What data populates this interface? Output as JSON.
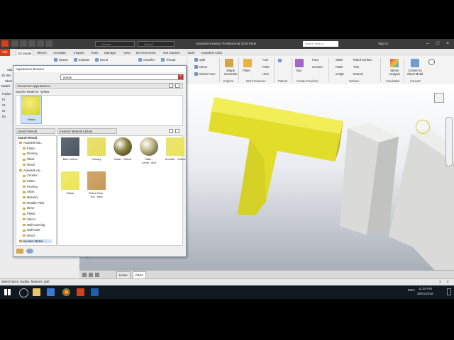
{
  "titlebar": {
    "app_title": "Autodesk Inventor Professional 2018    Part4",
    "style_combo": "Generic",
    "default_combo": "Default",
    "help_search_placeholder": "Search Help & Commands...",
    "signin": "Sign In"
  },
  "tabs": [
    "File",
    "3D Model",
    "Sketch",
    "Annotate",
    "Inspect",
    "Tools",
    "Manage",
    "View",
    "Environments",
    "Get Started",
    "Vault",
    "Autodesk A360"
  ],
  "ribbon": {
    "left_labels": [
      "Sweep",
      "Emboss",
      "Decal",
      "Chamfer",
      "Thread"
    ],
    "left_stubs": [
      "Star",
      "2D Ske",
      "Sketc"
    ],
    "modify": [
      "Split",
      "Direct",
      "Delete Face"
    ],
    "explore": {
      "label": "Shape Generator",
      "group": "Explore"
    },
    "plane": {
      "label": "Plane",
      "axis": "Axis",
      "point": "Point",
      "ucs": "UCS",
      "group": "Work Features"
    },
    "pattern_group": "Pattern",
    "freeform": {
      "box": "Box",
      "face": "Face",
      "convert": "Convert",
      "group": "Create Freeform"
    },
    "surface": {
      "items": [
        "Stitch",
        "Patch",
        "Sculpt",
        "Ruled Surface",
        "Trim",
        "Extend"
      ],
      "group": "Surface"
    },
    "simulation": {
      "label": "Stress Analysis",
      "group": "Simulation"
    },
    "convert": {
      "label": "Convert to Sheet Metal",
      "group": "Convert"
    }
  },
  "browser": {
    "model_label": "Model",
    "rows": [
      "Fusion",
      "Hi",
      "Sc",
      "Or",
      "En"
    ]
  },
  "dialog": {
    "title": "Appearance Browser",
    "search_value": "yellow",
    "doc_appearances": "Document Appearances",
    "search_results_for": "Search results for \"yellow\"",
    "doc_swatch_label": "Yellow",
    "search_result_dropdown": "Search Result",
    "library_dropdown": "Inventor Material Library",
    "tree_header": "Search Result",
    "tree": [
      {
        "label": "Autodesk Ma...",
        "level": 1
      },
      {
        "label": "Fabric",
        "level": 2
      },
      {
        "label": "Flooring",
        "level": 2
      },
      {
        "label": "Glass",
        "level": 2
      },
      {
        "label": "Wood",
        "level": 2
      },
      {
        "label": "Autodesk Ap...",
        "level": 1
      },
      {
        "label": "Ceramic",
        "level": 2
      },
      {
        "label": "Fabric",
        "level": 2
      },
      {
        "label": "Flooring",
        "level": 2
      },
      {
        "label": "Glass",
        "level": 2
      },
      {
        "label": "Masonry",
        "level": 2
      },
      {
        "label": "Metallic Paint",
        "level": 2
      },
      {
        "label": "Mirror",
        "level": 2
      },
      {
        "label": "Plastic",
        "level": 2
      },
      {
        "label": "Stucco",
        "level": 2
      },
      {
        "label": "Wall Covering",
        "level": 2
      },
      {
        "label": "Wall Paint",
        "level": 2
      },
      {
        "label": "Wood",
        "level": 2
      },
      {
        "label": "Inventor Materi...",
        "level": 1
      }
    ],
    "results": [
      {
        "label": "Blue-Yellow",
        "color": "#4a5563"
      },
      {
        "label": "Canary",
        "color": "#e6dc5c"
      },
      {
        "label": "Clear - Yellow",
        "color": "#8a7f3b"
      },
      {
        "label": "Satin - Lemo...ffon",
        "color": "#b9b07a"
      },
      {
        "label": "Smooth - Yellow",
        "color": "#e9e35a"
      },
      {
        "label": "Yellow",
        "color": "#ece55a"
      },
      {
        "label": "Yellow Pine - Sol...med",
        "color": "#c99858"
      }
    ]
  },
  "doc_tabs": {
    "home": "Home",
    "part": "Part4"
  },
  "status": {
    "text": "Select faces, bodies, features, part",
    "count1": "1",
    "count2": "2"
  },
  "taskbar": {
    "lang": "ENG",
    "time": "11:28 PM",
    "date": "28/01/2018"
  },
  "colors": {
    "accent": "#d4401c",
    "yellow_part": "#e0dc2a",
    "grey_part": "#d9d9d7",
    "highlight": "#cfe0f7"
  }
}
